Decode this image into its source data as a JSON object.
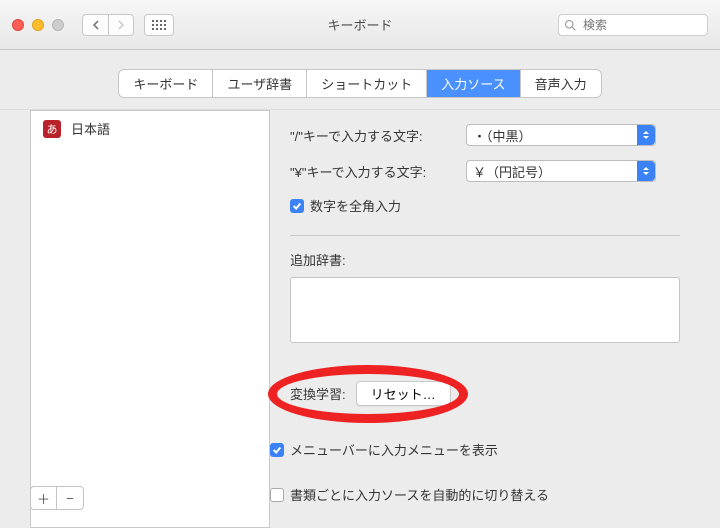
{
  "window": {
    "title": "キーボード"
  },
  "search": {
    "placeholder": "検索"
  },
  "tabs": {
    "keyboard": "キーボード",
    "user_dict": "ユーザ辞書",
    "shortcuts": "ショートカット",
    "input_sources": "入力ソース",
    "dictation": "音声入力"
  },
  "source": {
    "jp_label": "日本語",
    "badge": "あ"
  },
  "settings": {
    "slash_key_label": "\"/\"キーで入力する文字:",
    "slash_key_value": "・（中黒）",
    "yen_key_label": "\"¥\"キーで入力する文字:",
    "yen_key_value": "￥（円記号）",
    "fullwidth_digits_label": "数字を全角入力",
    "extra_dict_label": "追加辞書:",
    "learning_label": "変換学習:",
    "reset_button": "リセット…"
  },
  "footer": {
    "show_input_menu": "メニューバーに入力メニューを表示",
    "auto_switch": "書類ごとに入力ソースを自動的に切り替える",
    "plus": "＋",
    "minus": "−"
  }
}
